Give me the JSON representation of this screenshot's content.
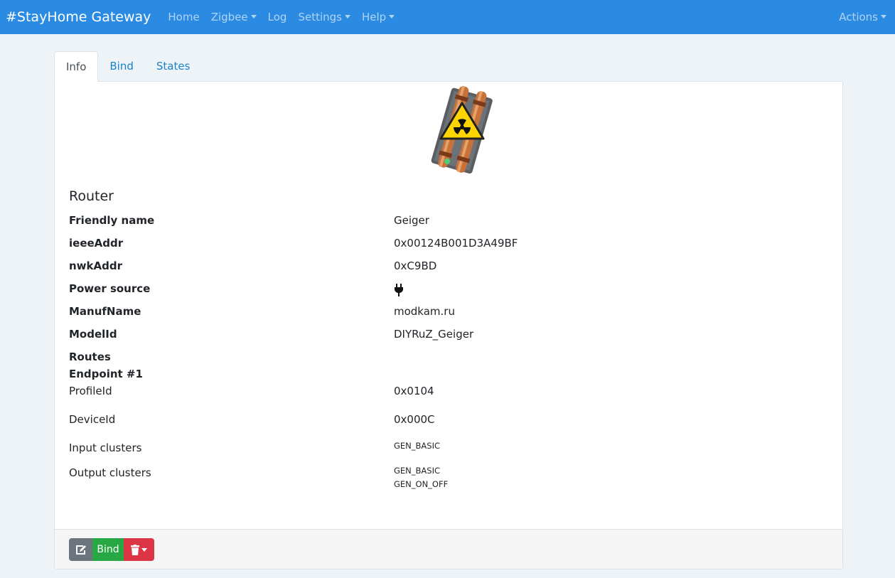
{
  "navbar": {
    "brand": "#StayHome Gateway",
    "items": [
      {
        "label": "Home"
      },
      {
        "label": "Zigbee",
        "dropdown": true
      },
      {
        "label": "Log"
      },
      {
        "label": "Settings",
        "dropdown": true
      },
      {
        "label": "Help",
        "dropdown": true
      }
    ],
    "actions": "Actions"
  },
  "tabs": [
    {
      "label": "Info",
      "active": true
    },
    {
      "label": "Bind"
    },
    {
      "label": "States"
    }
  ],
  "device": {
    "image_icon": "geiger-counter-radiation-icon",
    "type": "Router",
    "fields": [
      {
        "label": "Friendly name",
        "value": "Geiger"
      },
      {
        "label": "ieeeAddr",
        "value": "0x00124B001D3A49BF"
      },
      {
        "label": "nwkAddr",
        "value": "0xC9BD"
      },
      {
        "label": "Power source",
        "value_icon": "plug-icon"
      },
      {
        "label": "ManufName",
        "value": "modkam.ru"
      },
      {
        "label": "ModelId",
        "value": "DIYRuZ_Geiger"
      },
      {
        "label": "Routes"
      }
    ],
    "endpoint": {
      "title": "Endpoint #1",
      "profile_label": "ProfileId",
      "profile_value": "0x0104",
      "device_label": "DeviceId",
      "device_value": "0x000C",
      "input_label": "Input clusters",
      "input_clusters": [
        "GEN_BASIC"
      ],
      "output_label": "Output clusters",
      "output_clusters": [
        "GEN_BASIC",
        "GEN_ON_OFF"
      ]
    }
  },
  "footer": {
    "edit_icon": "edit-icon",
    "bind_label": "Bind",
    "delete_icon": "trash-icon"
  },
  "colors": {
    "navbar": "#2b8be3",
    "background": "#edf3f7",
    "link": "#1a82c8",
    "edit_button": "#6c757d",
    "bind_button": "#28a745",
    "delete_button": "#dc3545"
  }
}
